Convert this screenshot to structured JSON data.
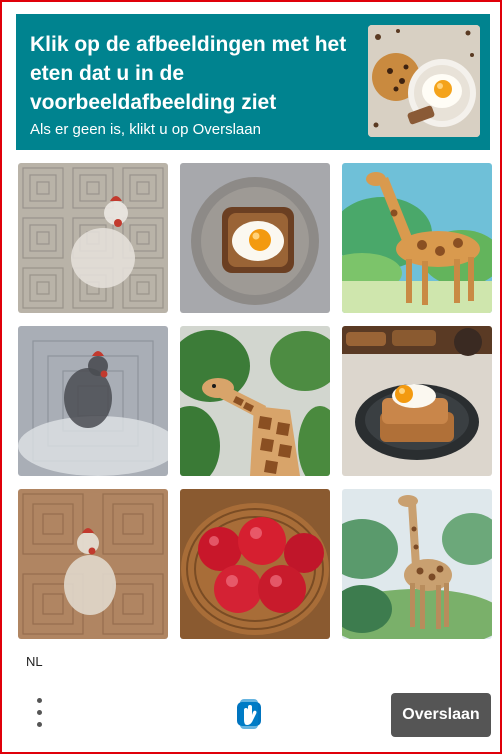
{
  "header": {
    "title": "Klik op de afbeeldingen met het eten dat u in de voorbeeldafbeelding ziet",
    "subtitle": "Als er geen is, klikt u op Overslaan",
    "background_color": "#00838f"
  },
  "sample_image": {
    "description_icon": "cookie-and-fried-egg-image"
  },
  "grid": {
    "tiles": [
      {
        "subject": "chicken"
      },
      {
        "subject": "egg-on-toast"
      },
      {
        "subject": "giraffe"
      },
      {
        "subject": "chicken"
      },
      {
        "subject": "giraffe"
      },
      {
        "subject": "egg-on-toast"
      },
      {
        "subject": "chicken"
      },
      {
        "subject": "apples-in-basket"
      },
      {
        "subject": "giraffe"
      }
    ]
  },
  "footer": {
    "language": "NL",
    "skip_label": "Overslaan",
    "skip_color": "#555555",
    "menu_icon": "more-vertical-icon",
    "logo_icon": "hcaptcha-hand-icon"
  },
  "frame_color": "#e0000a"
}
